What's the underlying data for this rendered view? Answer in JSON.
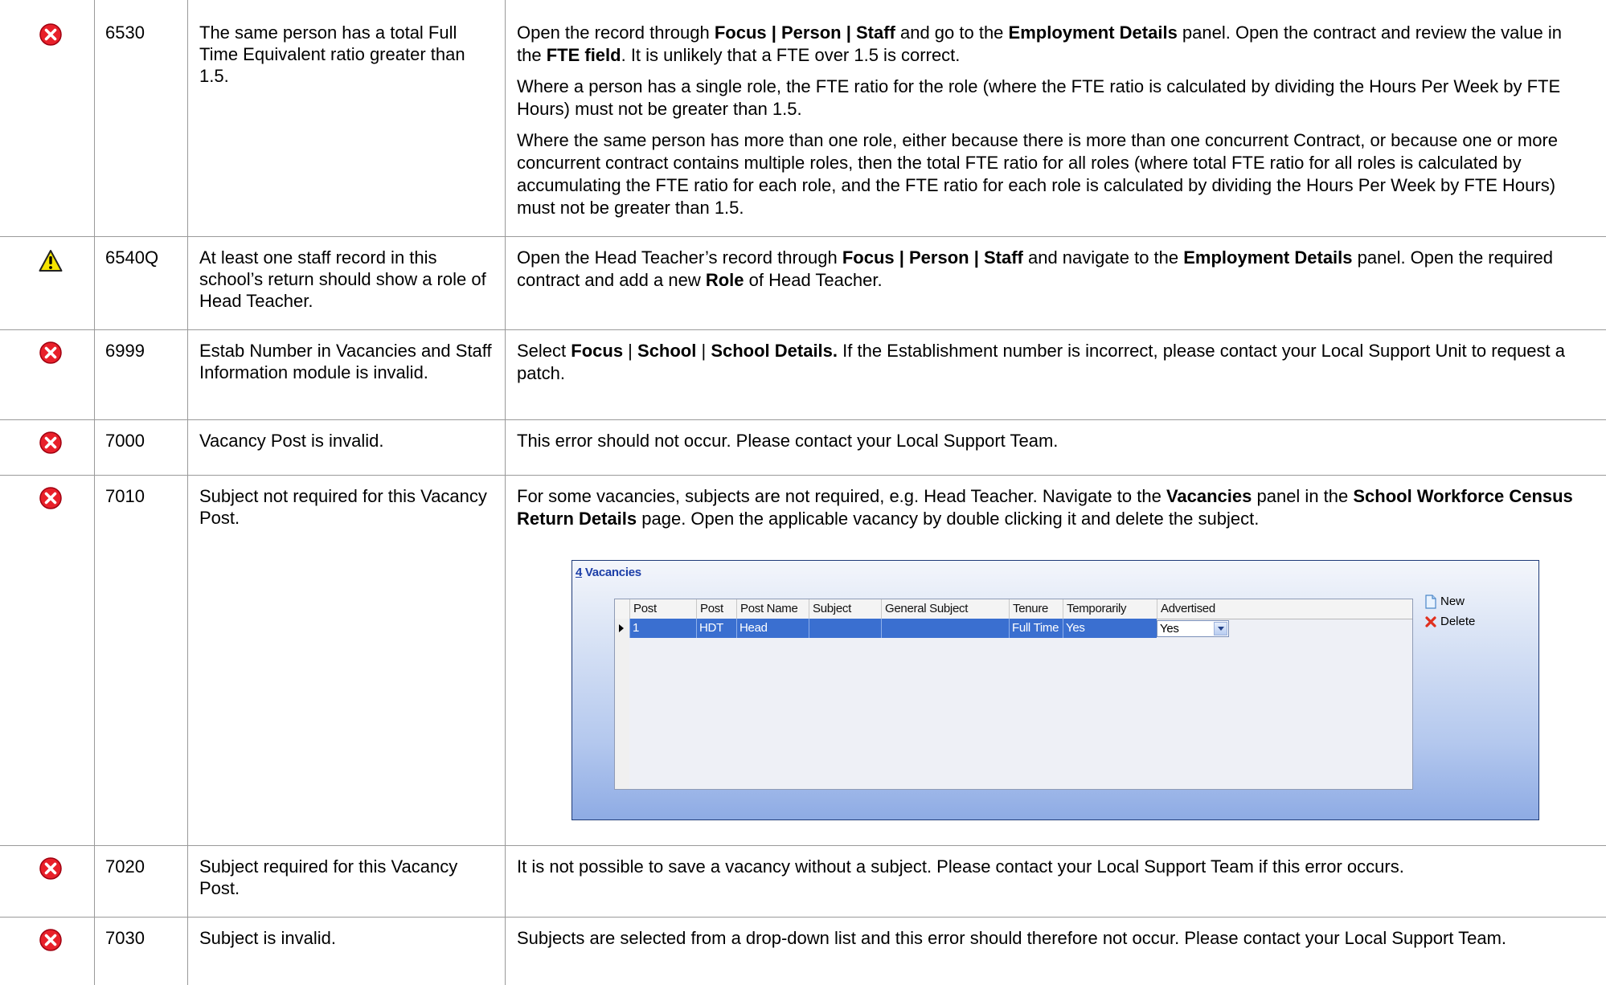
{
  "rows": [
    {
      "severity": "error",
      "code": "6530",
      "description": "The same person has a total Full Time Equivalent ratio greater than 1.5.",
      "resolution": [
        [
          {
            "t": "Open the record through "
          },
          {
            "t": "Focus | Person | Staff",
            "b": true
          },
          {
            "t": " and go to the "
          },
          {
            "t": "Employment Details",
            "b": true
          },
          {
            "t": " panel. Open the contract and review the value in the "
          },
          {
            "t": "FTE field",
            "b": true
          },
          {
            "t": ". It is unlikely that a FTE over 1.5 is correct."
          }
        ],
        [
          {
            "t": "Where a person has a single role, the FTE ratio for the role (where the FTE ratio is calculated by dividing the Hours Per Week by FTE Hours) must not be greater than 1.5."
          }
        ],
        [
          {
            "t": "Where the same person has more than one role, either because there is more than one concurrent Contract, or because one or more concurrent contract contains multiple roles, then the total FTE ratio for all roles (where total FTE ratio for all roles is calculated by accumulating the FTE ratio for each role, and the FTE ratio for each role is calculated by dividing the Hours Per Week by FTE Hours) must not be greater than 1.5."
          }
        ]
      ]
    },
    {
      "severity": "warning",
      "code": "6540Q",
      "description": "At least one staff record in this school’s return should show a role of Head Teacher.",
      "resolution": [
        [
          {
            "t": "Open the Head Teacher’s record through "
          },
          {
            "t": "Focus | Person | Staff",
            "b": true
          },
          {
            "t": " and navigate to the "
          },
          {
            "t": "Employment Details",
            "b": true
          },
          {
            "t": " panel. Open the required contract and add a new "
          },
          {
            "t": "Role",
            "b": true
          },
          {
            "t": " of Head Teacher."
          }
        ]
      ]
    },
    {
      "severity": "error",
      "code": "6999",
      "description": "Estab Number in Vacancies and Staff Information module is invalid.",
      "resolution": [
        [
          {
            "t": "Select "
          },
          {
            "t": "Focus",
            "b": true
          },
          {
            "t": " | "
          },
          {
            "t": "School",
            "b": true
          },
          {
            "t": " | "
          },
          {
            "t": "School Details.",
            "b": true
          },
          {
            "t": " If the Establishment number is incorrect, please contact your Local Support Unit to request a patch."
          }
        ]
      ]
    },
    {
      "severity": "error",
      "code": "7000",
      "description": "Vacancy Post is invalid.",
      "resolution": [
        [
          {
            "t": "This error should not occur. Please contact your Local Support Team."
          }
        ]
      ]
    },
    {
      "severity": "error",
      "code": "7010",
      "description": "Subject not required for this Vacancy Post.",
      "resolution": [
        [
          {
            "t": "For some vacancies, subjects are not required, e.g. Head Teacher. Navigate to the "
          },
          {
            "t": "Vacancies",
            "b": true
          },
          {
            "t": " panel in the "
          },
          {
            "t": "School Workforce Census Return Details",
            "b": true
          },
          {
            "t": " page. Open the applicable vacancy by double clicking it and delete the subject."
          }
        ]
      ]
    },
    {
      "severity": "error",
      "code": "7020",
      "description": "Subject required for this Vacancy Post.",
      "resolution": [
        [
          {
            "t": "It is not possible to save a vacancy without a subject. Please contact your Local Support Team if this error occurs."
          }
        ]
      ]
    },
    {
      "severity": "error",
      "code": "7030",
      "description": "Subject is invalid.",
      "resolution": [
        [
          {
            "t": "Subjects are selected from a drop-down list and this error should therefore not occur. Please contact your Local Support Team."
          }
        ]
      ]
    }
  ],
  "vacancies_panel": {
    "number": "4",
    "title": "Vacancies",
    "columns": [
      "Post Number",
      "Post",
      "Post Name",
      "Subject Code",
      "General Subject",
      "Tenure",
      "Temporarily Filled",
      "Advertised"
    ],
    "row": {
      "post_number": "1",
      "post": "HDT",
      "post_name": "Head teacher",
      "subject_code": "",
      "general_subject": "",
      "tenure": "Full Time",
      "temporarily_filled": "Yes",
      "advertised": "Yes"
    },
    "new_label": "New",
    "delete_label": "Delete"
  },
  "colors": {
    "error": "#e8202a",
    "warning": "#f5e400",
    "grid_selection": "#3a6fd0",
    "panel_title": "#1d3fa8"
  },
  "icons": {
    "error": "error-circle-x-icon",
    "warning": "warning-triangle-icon",
    "row_pointer": "row-pointer-icon",
    "new": "new-document-icon",
    "delete": "delete-x-icon"
  }
}
